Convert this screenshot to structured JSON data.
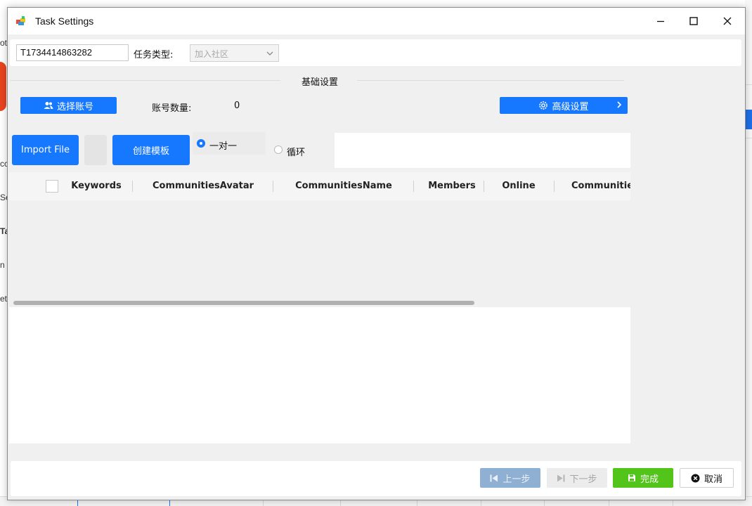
{
  "window": {
    "title": "Task Settings",
    "controls": {
      "minimize": "—",
      "maximize": "☐",
      "close": "✕"
    }
  },
  "top": {
    "task_id": "T1734414863282",
    "task_type_label": "任务类型:",
    "task_type_value": "加入社区"
  },
  "basic": {
    "section_title": "基础设置",
    "select_account": "选择账号",
    "account_count_label": "账号数量:",
    "account_count": "0",
    "advanced": "高级设置"
  },
  "toolbar": {
    "import_file": "Import File",
    "create_template": "创建模板",
    "radio_one_to_one": "一对一",
    "radio_loop": "循环"
  },
  "grid": {
    "columns": [
      "Keywords",
      "CommunitiesAvatar",
      "CommunitiesName",
      "Members",
      "Online",
      "Communities"
    ]
  },
  "footer": {
    "prev": "上一步",
    "next": "下一步",
    "finish": "完成",
    "cancel": "取消"
  },
  "colors": {
    "primary": "#1677ff",
    "success": "#52c41a",
    "disabled_blue": "#8fb0d3"
  }
}
